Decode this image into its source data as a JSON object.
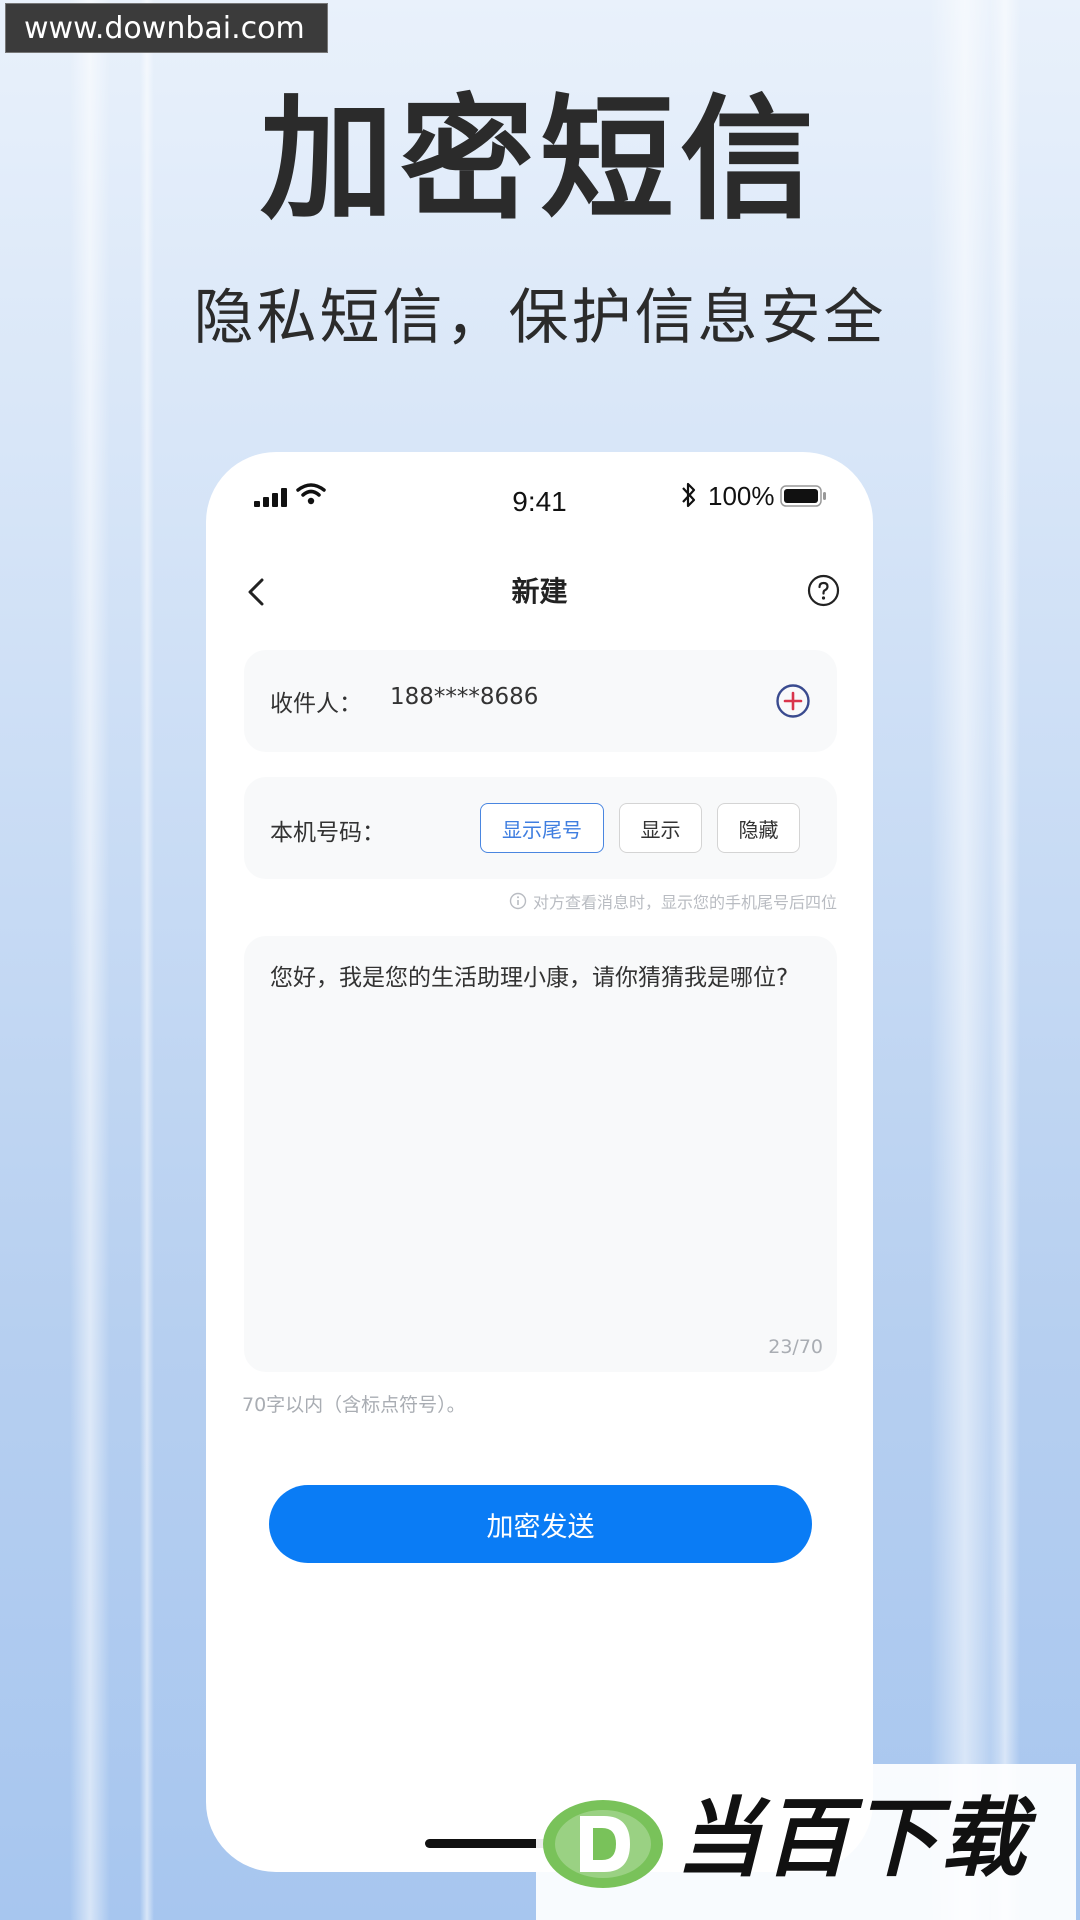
{
  "watermark": {
    "site": "www.downbai.com"
  },
  "hero": {
    "title": "加密短信",
    "subtitle": "隐私短信，保护信息安全"
  },
  "status_bar": {
    "time": "9:41",
    "battery": "100%"
  },
  "nav": {
    "title": "新建"
  },
  "recipient": {
    "label": "收件人：",
    "value": "188****8686"
  },
  "own_number": {
    "label": "本机号码：",
    "options": [
      "显示尾号",
      "显示",
      "隐藏"
    ],
    "selected": "显示尾号",
    "hint": "对方查看消息时，显示您的手机尾号后四位"
  },
  "message": {
    "text": "您好，我是您的生活助理小康，请你猜猜我是哪位?",
    "counter": "23/70",
    "limit_note": "70字以内（含标点符号）。"
  },
  "send_button": {
    "label": "加密发送"
  },
  "brand": {
    "name": "当百下载"
  },
  "colors": {
    "accent": "#0a7cf5",
    "selected_border": "#4a86e0",
    "add_icon": "#d9344b"
  }
}
